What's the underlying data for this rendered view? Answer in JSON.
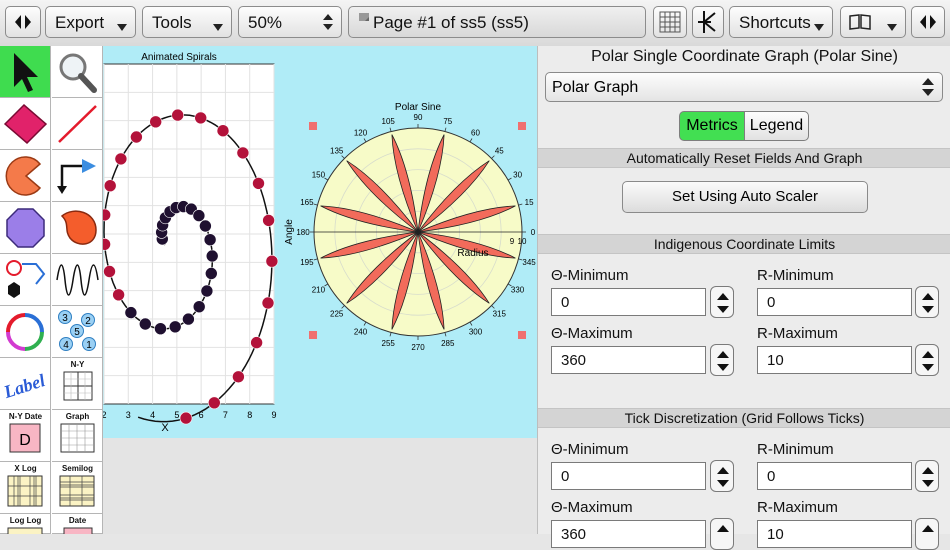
{
  "toolbar": {
    "export_label": "Export",
    "tools_label": "Tools",
    "zoom_label": "50%",
    "page_label": "Page #1 of ss5 (ss5)",
    "shortcuts_label": "Shortcuts"
  },
  "sidebar": {
    "label_tool": "Label",
    "captions": [
      "N-Y",
      "N-Y Date",
      "Graph",
      "X Log",
      "Semilog",
      "Log Log",
      "Date"
    ],
    "date_glyph": "D",
    "bubble_numbers": [
      "3",
      "2",
      "5",
      "4",
      "1"
    ]
  },
  "spiral_graph": {
    "title": "Animated Spirals",
    "xlabel": "X",
    "x_ticks": [
      "2",
      "3",
      "4",
      "5",
      "6",
      "7",
      "8",
      "9"
    ],
    "colors": {
      "point_dark": "#1f1030",
      "point_red": "#b3123a"
    }
  },
  "polar_graph": {
    "title": "Polar Sine",
    "angle_axis_label": "Angle",
    "radius_axis_label": "Radius",
    "angle_ticks": [
      "90",
      "75",
      "60",
      "45",
      "30",
      "15",
      "0",
      "345",
      "330",
      "315",
      "300",
      "285",
      "270",
      "255",
      "240",
      "225",
      "210",
      "195",
      "180",
      "165",
      "150",
      "135",
      "120",
      "105"
    ],
    "radius_ticks": [
      "9",
      "10"
    ],
    "colors": {
      "disk": "#f7fbc8",
      "petal": "#f26b5b"
    }
  },
  "panel": {
    "title": "Polar Single Coordinate Graph (Polar Sine)",
    "graph_type": "Polar Graph",
    "tab_metrics": "Metrics",
    "tab_legend": "Legend",
    "section_auto": "Automatically Reset Fields And Graph",
    "auto_button": "Set Using Auto Scaler",
    "section_limits": "Indigenous Coordinate Limits",
    "section_ticks": "Tick Discretization (Grid Follows Ticks)",
    "limits": {
      "theta_min_label": "Θ-Minimum",
      "theta_min": "0",
      "r_min_label": "R-Minimum",
      "r_min": "0",
      "theta_max_label": "Θ-Maximum",
      "theta_max": "360",
      "r_max_label": "R-Maximum",
      "r_max": "10"
    },
    "ticks": {
      "theta_min_label": "Θ-Minimum",
      "theta_min": "0",
      "r_min_label": "R-Minimum",
      "r_min": "0",
      "theta_max_label": "Θ-Maximum",
      "theta_max": "360",
      "r_max_label": "R-Maximum",
      "r_max": "10"
    }
  }
}
